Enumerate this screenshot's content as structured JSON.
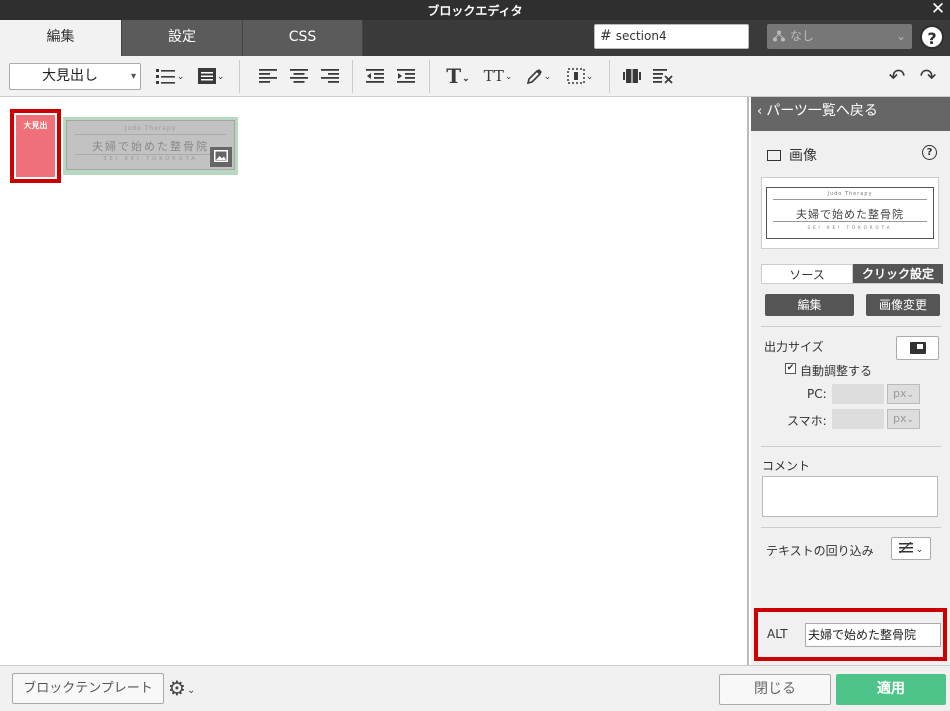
{
  "window": {
    "title": "ブロックエディタ",
    "close_glyph": "✕"
  },
  "tabs": [
    {
      "label": "編集",
      "active": true
    },
    {
      "label": "設定",
      "active": false
    },
    {
      "label": "CSS",
      "active": false
    }
  ],
  "section_input": {
    "hash": "#",
    "value": "section4"
  },
  "class_select": {
    "icon": "network-icon",
    "value": "なし"
  },
  "help_glyph": "?",
  "toolbar": {
    "heading_select": "大見出し",
    "icons": [
      "bullet-list-icon",
      "block-icon",
      "align-left-icon",
      "align-center-icon",
      "align-right-icon",
      "outdent-icon",
      "indent-icon",
      "text-style-icon",
      "font-size-icon",
      "color-picker-icon",
      "border-icon",
      "columns-icon",
      "clear-format-icon",
      "undo-icon",
      "redo-icon"
    ]
  },
  "canvas": {
    "block_label": "大見出",
    "image": {
      "top_text": "Judo Therapy",
      "main_text": "夫婦で始めた整骨院",
      "bottom_text": "SEI KEI TOKOROTA"
    }
  },
  "panel": {
    "back_label": "パーツ一覧へ戻る",
    "part_title": "画像",
    "help_glyph": "?",
    "preview": {
      "top_text": "Judo Therapy",
      "main_text": "夫婦で始めた整骨院",
      "bottom_text": "SEI KEI TOKOROTA"
    },
    "subtabs": {
      "source": "ソース",
      "click": "クリック設定"
    },
    "edit_button": "編集",
    "change_image_button": "画像変更",
    "output_size_label": "出力サイズ",
    "auto_adjust_label": "自動調整する",
    "auto_adjust_checked": true,
    "pc_label": "PC:",
    "sp_label": "スマホ:",
    "unit": "px",
    "comment_label": "コメント",
    "comment_value": "",
    "text_wrap_label": "テキストの回り込み",
    "alt_label": "ALT",
    "alt_value": "夫婦で始めた整骨院"
  },
  "footer": {
    "template_button": "ブロックテンプレート",
    "close_button": "閉じる",
    "apply_button": "適用"
  },
  "colors": {
    "titlebar": "#2f2f2f",
    "apply_green": "#4fc48a",
    "highlight_red": "#cc0000",
    "block_pink": "#ef7079"
  }
}
